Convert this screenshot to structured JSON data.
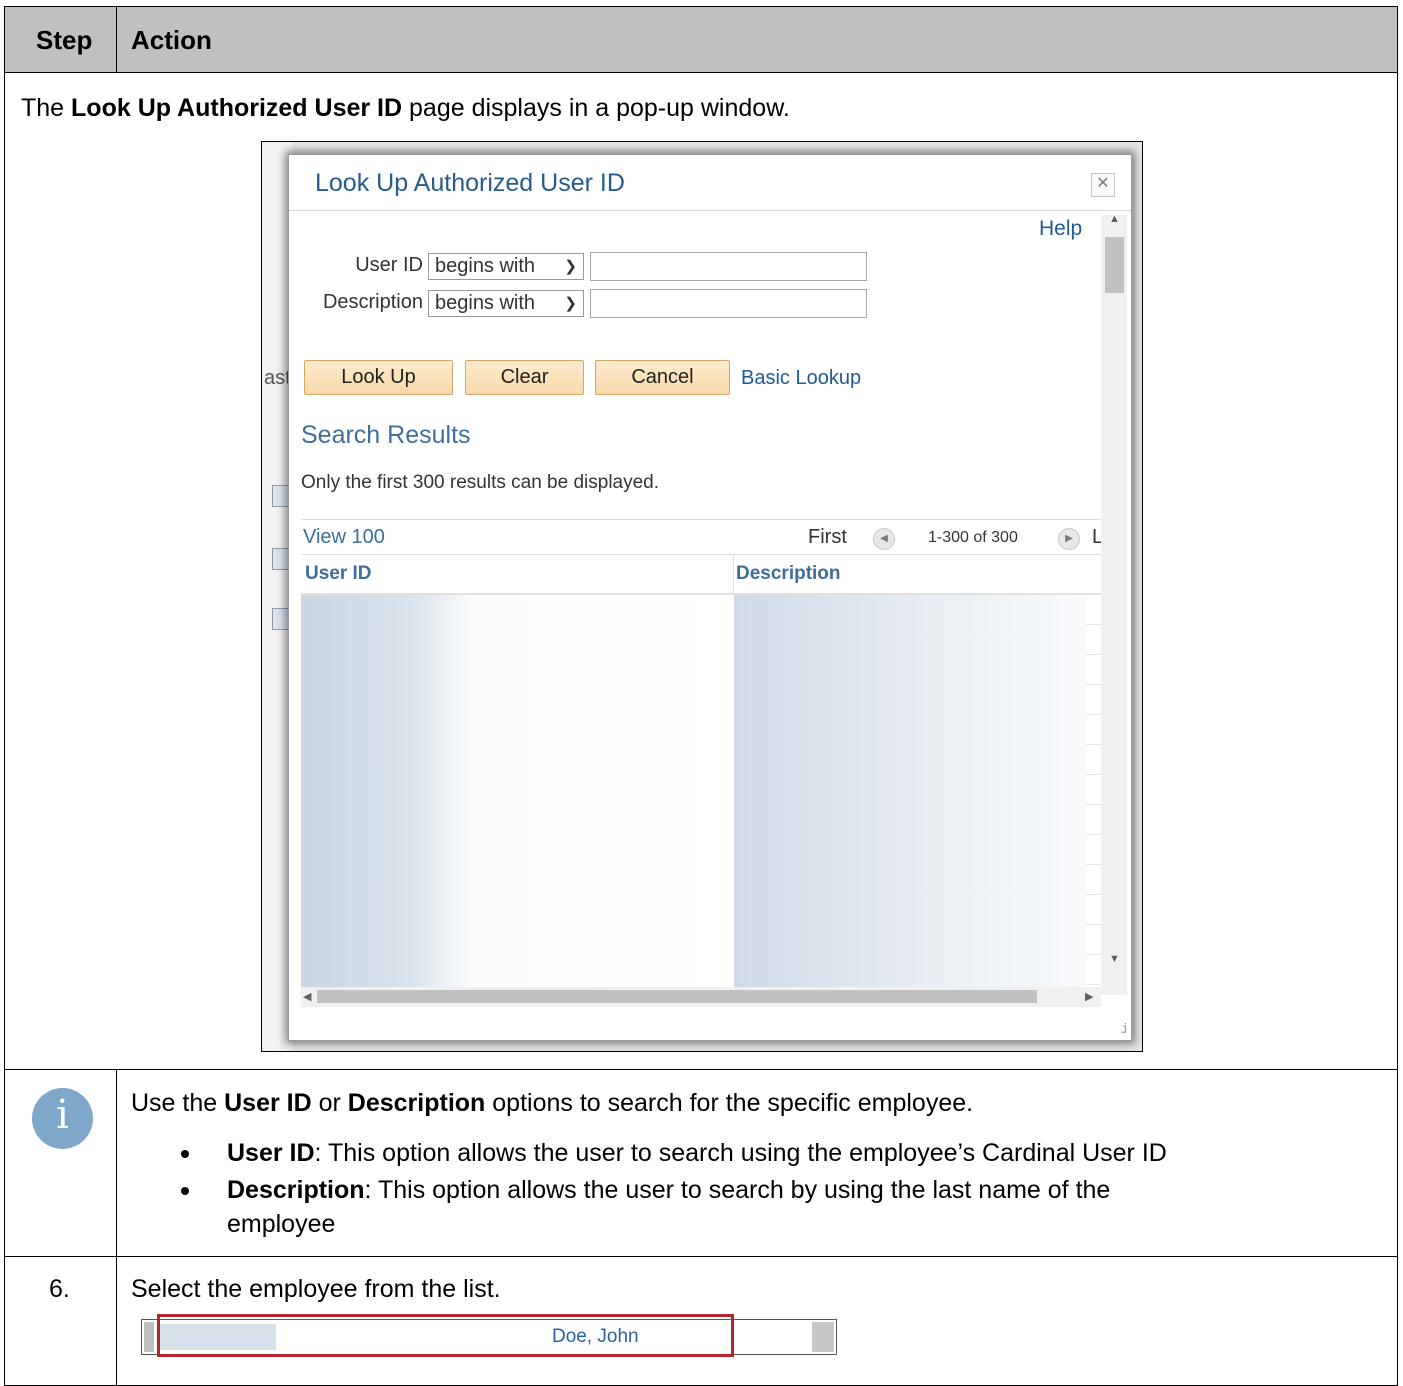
{
  "table": {
    "header": {
      "step": "Step",
      "action": "Action"
    },
    "row1": {
      "text_prefix": "The ",
      "text_bold": "Look Up Authorized User ID",
      "text_suffix": " page displays in a pop-up window."
    },
    "note": {
      "icon": "info-icon",
      "intro_prefix": "Use the ",
      "intro_bold1": "User ID",
      "intro_mid": " or ",
      "intro_bold2": "Description",
      "intro_suffix": " options to search for the specific employee.",
      "bullets": [
        {
          "bold": "User ID",
          "text": ": This option allows the user to search using the employee’s Cardinal User ID"
        },
        {
          "bold": "Description",
          "text": ": This option allows the user to search by using the last name of the",
          "text_line2": "employee"
        }
      ]
    },
    "step6": {
      "number": "6.",
      "text": "Select the employee from the list.",
      "selected_name": "Doe, John"
    }
  },
  "dialog": {
    "title": "Look Up Authorized User ID",
    "close_icon": "close-icon",
    "help": "Help",
    "background_fragment": "ast",
    "fields": [
      {
        "label": "User ID",
        "operator": "begins with",
        "value": ""
      },
      {
        "label": "Description",
        "operator": "begins with",
        "value": ""
      }
    ],
    "buttons": {
      "lookup": "Look Up",
      "clear": "Clear",
      "cancel": "Cancel"
    },
    "basic_lookup": "Basic Lookup",
    "search_results": "Search Results",
    "limit_note": "Only the first 300 results can be displayed.",
    "grid": {
      "view_link": "View 100",
      "first": "First",
      "range": "1-300 of 300",
      "last_fragment": "L",
      "columns": [
        "User ID",
        "Description"
      ]
    }
  },
  "colors": {
    "link": "#1e5b96",
    "header_bg": "#c0c0c0",
    "highlight": "#b5242f",
    "info_icon": "#7ea7c9"
  }
}
